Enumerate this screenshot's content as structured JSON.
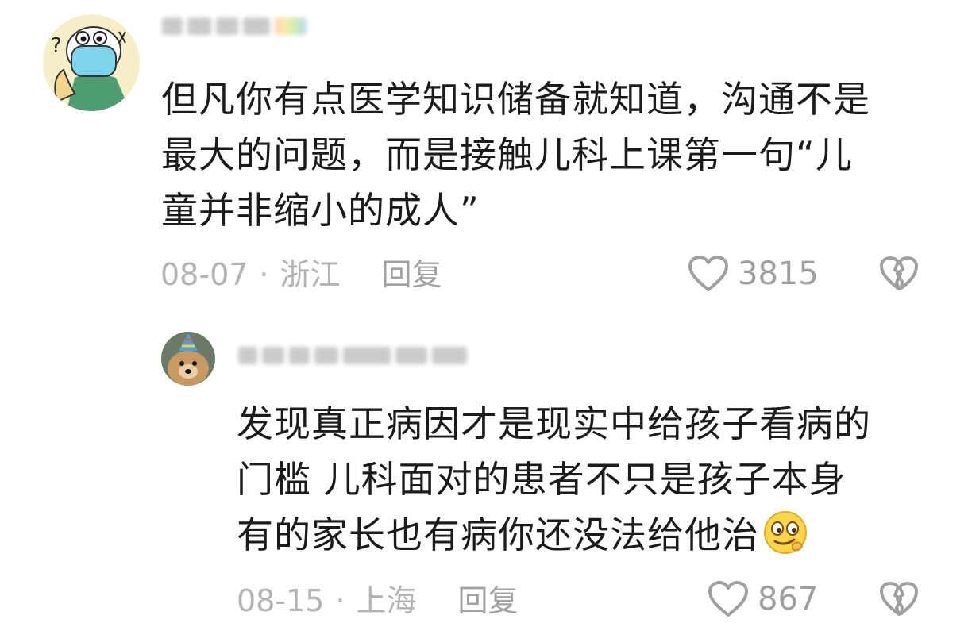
{
  "comments": [
    {
      "avatar_icon": "cartoon-masked-character-avatar",
      "text_lines": [
        "但凡你有点医学知识储备就知道，沟通不是",
        "最大的问题，而是接触儿科上课第一句“儿",
        "童并非缩小的成人”"
      ],
      "date": "08-07",
      "separator": "·",
      "location": "浙江",
      "reply_label": "回复",
      "like_count": "3815",
      "like_icon": "heart-outline-icon",
      "dislike_icon": "broken-heart-icon"
    },
    {
      "avatar_icon": "dog-with-party-hat-avatar",
      "text_lines": [
        "发现真正病因才是现实中给孩子看病的",
        "门槛 儿科面对的患者不只是孩子本身",
        "有的家长也有病你还没法给他治"
      ],
      "emoji_icon": "smirking-face-emoji-icon",
      "date": "08-15",
      "separator": "·",
      "location": "上海",
      "reply_label": "回复",
      "like_count": "867",
      "like_icon": "heart-outline-icon",
      "dislike_icon": "broken-heart-icon"
    }
  ],
  "colors": {
    "text": "#1b1b1b",
    "meta": "#b3b3b3",
    "icon": "#9f9f9f"
  }
}
